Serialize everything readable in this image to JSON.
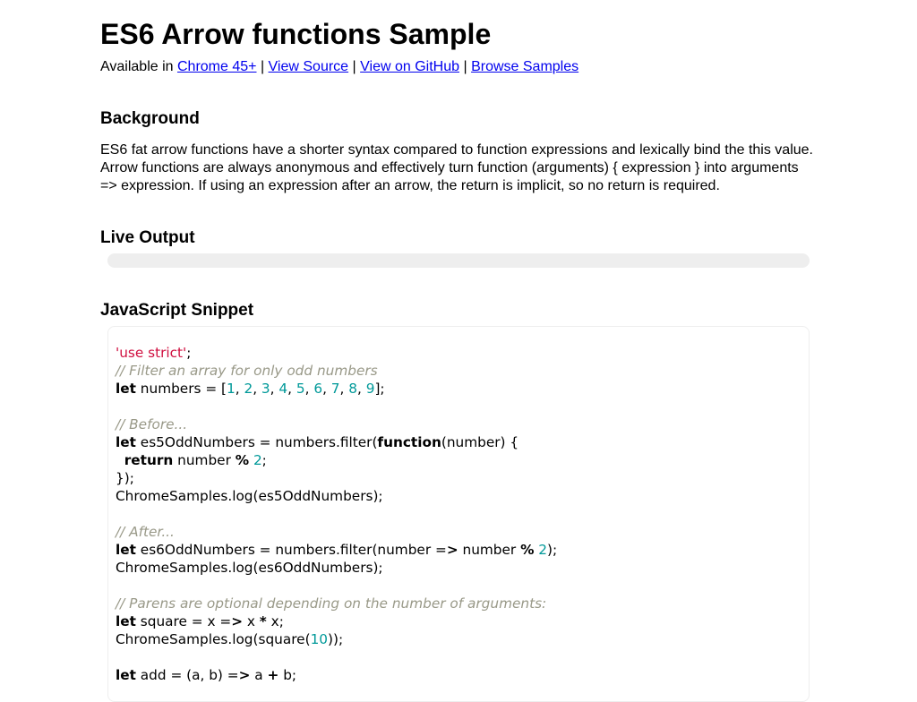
{
  "title": "ES6 Arrow functions Sample",
  "availability": {
    "prefix": "Available in ",
    "links": [
      {
        "label": "Chrome 45+"
      },
      {
        "label": "View Source"
      },
      {
        "label": "View on GitHub"
      },
      {
        "label": "Browse Samples"
      }
    ],
    "separator": "|"
  },
  "background": {
    "heading": "Background",
    "text": "ES6 fat arrow functions have a shorter syntax compared to function expressions and lexically bind the this value. Arrow functions are always anonymous and effectively turn function (arguments) { expression } into arguments => expression. If using an expression after an arrow, the return is implicit, so no return is required."
  },
  "live_output": {
    "heading": "Live Output"
  },
  "snippet": {
    "heading": "JavaScript Snippet",
    "lines": [
      [
        [
          "str",
          "'use strict'"
        ],
        [
          "",
          ";"
        ]
      ],
      [
        [
          "com",
          "// Filter an array for only odd numbers"
        ]
      ],
      [
        [
          "kw",
          "let"
        ],
        [
          "",
          " numbers = ["
        ],
        [
          "num",
          "1"
        ],
        [
          "",
          ", "
        ],
        [
          "num",
          "2"
        ],
        [
          "",
          ", "
        ],
        [
          "num",
          "3"
        ],
        [
          "",
          ", "
        ],
        [
          "num",
          "4"
        ],
        [
          "",
          ", "
        ],
        [
          "num",
          "5"
        ],
        [
          "",
          ", "
        ],
        [
          "num",
          "6"
        ],
        [
          "",
          ", "
        ],
        [
          "num",
          "7"
        ],
        [
          "",
          ", "
        ],
        [
          "num",
          "8"
        ],
        [
          "",
          ", "
        ],
        [
          "num",
          "9"
        ],
        [
          "",
          "];"
        ]
      ],
      [],
      [
        [
          "com",
          "// Before..."
        ]
      ],
      [
        [
          "kw",
          "let"
        ],
        [
          "",
          " es5OddNumbers = numbers.filter("
        ],
        [
          "kw",
          "function"
        ],
        [
          "",
          "(number) {"
        ]
      ],
      [
        [
          "",
          "  "
        ],
        [
          "kw",
          "return"
        ],
        [
          "",
          " number "
        ],
        [
          "op",
          "%"
        ],
        [
          "",
          " "
        ],
        [
          "num",
          "2"
        ],
        [
          "",
          ";"
        ]
      ],
      [
        [
          "",
          "});"
        ]
      ],
      [
        [
          "",
          "ChromeSamples.log(es5OddNumbers);"
        ]
      ],
      [],
      [
        [
          "com",
          "// After..."
        ]
      ],
      [
        [
          "kw",
          "let"
        ],
        [
          "",
          " es6OddNumbers = numbers.filter(number ="
        ],
        [
          "op",
          ">"
        ],
        [
          "",
          " number "
        ],
        [
          "op",
          "%"
        ],
        [
          "",
          " "
        ],
        [
          "num",
          "2"
        ],
        [
          "",
          ");"
        ]
      ],
      [
        [
          "",
          "ChromeSamples.log(es6OddNumbers);"
        ]
      ],
      [],
      [
        [
          "com",
          "// Parens are optional depending on the number of arguments:"
        ]
      ],
      [
        [
          "kw",
          "let"
        ],
        [
          "",
          " square = x ="
        ],
        [
          "op",
          ">"
        ],
        [
          "",
          " x "
        ],
        [
          "op",
          "*"
        ],
        [
          "",
          " x;"
        ]
      ],
      [
        [
          "",
          "ChromeSamples.log(square("
        ],
        [
          "num",
          "10"
        ],
        [
          "",
          "));"
        ]
      ],
      [],
      [
        [
          "kw",
          "let"
        ],
        [
          "",
          " add = (a, b) ="
        ],
        [
          "op",
          ">"
        ],
        [
          "",
          " a "
        ],
        [
          "op",
          "+"
        ],
        [
          "",
          " b;"
        ]
      ]
    ]
  }
}
